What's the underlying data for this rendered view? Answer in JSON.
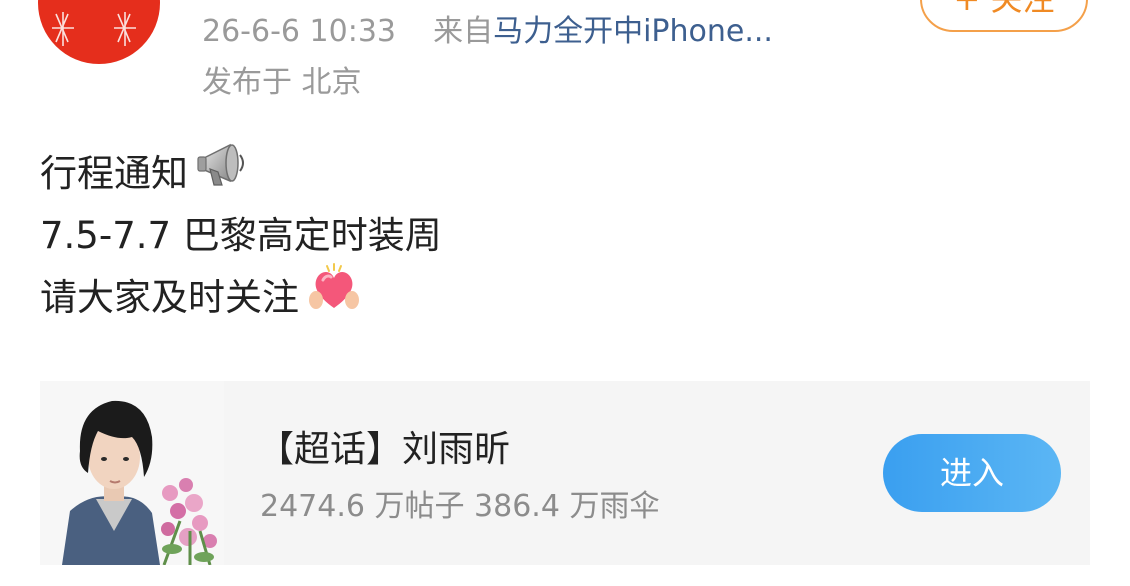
{
  "header": {
    "date_time": "26-6-6 10:33",
    "source_prefix": "来自",
    "source_name": "马力全开中iPhone...",
    "location": "发布于 北京",
    "follow_label": "+ 关注"
  },
  "post": {
    "lines": [
      "行程通知",
      "7.5-7.7 巴黎高定时装周",
      "请大家及时关注"
    ],
    "emoji_1": "megaphone-icon",
    "emoji_2": "heart-hands-icon"
  },
  "topic_card": {
    "title": "【超话】刘雨昕",
    "stats": "2474.6 万帖子 386.4 万雨伞",
    "enter_label": "进入"
  },
  "colors": {
    "avatar_red": "#e52e1c",
    "source_link": "#3d5f8f",
    "follow_orange": "#f08a24",
    "enter_blue": "#3a9ff0"
  }
}
